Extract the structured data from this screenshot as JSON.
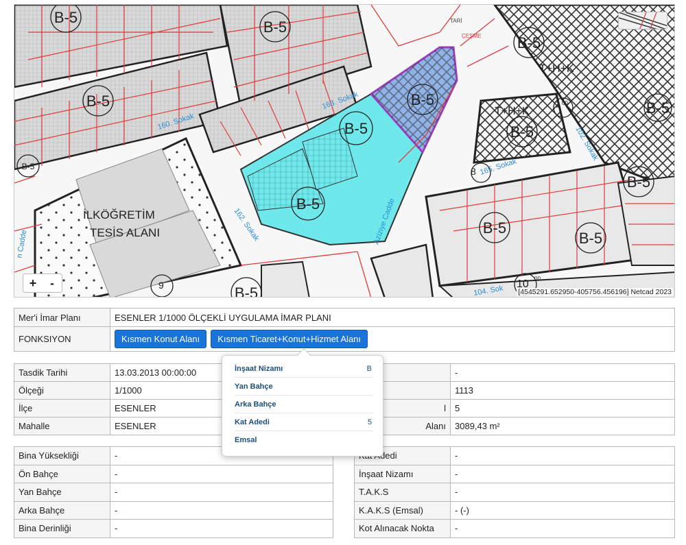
{
  "map": {
    "zoom_in": "+",
    "zoom_out": "-",
    "attribution": "[4545291.652950-405756.456196] Netcad 2023",
    "labels": {
      "zone": "B-5",
      "school_line1": "İLKÖĞRETİM",
      "school_line2": "TESİS ALANI",
      "street_160": "160. Sokak",
      "street_163": "163. Sokak",
      "street_162": "162. Sokak",
      "street_165": "165. Sokak",
      "street_102": "102. Sokak",
      "street_104": "104. Sok",
      "cadde_aziziye": "Aziziye Cadde",
      "cadde_left": "n Cadde",
      "cesme": "ÇEŞME",
      "tarih": "TARİ",
      "thk": "T+H+K",
      "num_7": "7",
      "num_8": "8",
      "num_9": "9",
      "num_10": "10",
      "num_00": "00"
    }
  },
  "plan": {
    "label_plan": "Mer'i İmar Planı",
    "value_plan": "ESENLER 1/1000 ÖLÇEKLİ UYGULAMA İMAR PLANI",
    "label_function": "FONKSIYON",
    "button_konut": "Kısmen Konut Alanı",
    "button_ticaret": "Kısmen Ticaret+Konut+Hizmet Alanı"
  },
  "info": {
    "rows": [
      {
        "label": "Tasdik Tarihi",
        "value": "13.03.2013 00:00:00",
        "label2": "",
        "value2": "-"
      },
      {
        "label": "Ölçeği",
        "value": "1/1000",
        "label2": "",
        "value2": "1113"
      },
      {
        "label": "İlçe",
        "value": "ESENLER",
        "label2": "l",
        "value2": "5"
      },
      {
        "label": "Mahalle",
        "value": "ESENLER",
        "label2": "Alanı",
        "value2": "3089,43 m²"
      }
    ]
  },
  "left_table": [
    {
      "label": "Bina Yüksekliği",
      "value": "-"
    },
    {
      "label": "Ön Bahçe",
      "value": "-"
    },
    {
      "label": "Yan Bahçe",
      "value": "-"
    },
    {
      "label": "Arka Bahçe",
      "value": "-"
    },
    {
      "label": "Bina Derinliği",
      "value": "-"
    }
  ],
  "right_table": [
    {
      "label": "Kat Adedi",
      "value": "-"
    },
    {
      "label": "İnşaat Nizamı",
      "value": "-"
    },
    {
      "label": "T.A.K.S",
      "value": "-"
    },
    {
      "label": "K.A.K.S (Emsal)",
      "value": "- (-)"
    },
    {
      "label": "Kot Alınacak Nokta",
      "value": "-"
    }
  ],
  "popover": {
    "rows": [
      {
        "label": "İnşaat Nizamı",
        "value": "B"
      },
      {
        "label": "Yan Bahçe",
        "value": ""
      },
      {
        "label": "Arka Bahçe",
        "value": ""
      },
      {
        "label": "Kat Adedi",
        "value": "5"
      },
      {
        "label": "Emsal",
        "value": ""
      }
    ]
  },
  "colors": {
    "parcel_cyan": "#6fe8ec",
    "parcel_blue": "#8fb3e8",
    "parcel_outline": "#9b3fbf",
    "lot_lines": "#e03a3a",
    "button_blue": "#1a73d9"
  }
}
